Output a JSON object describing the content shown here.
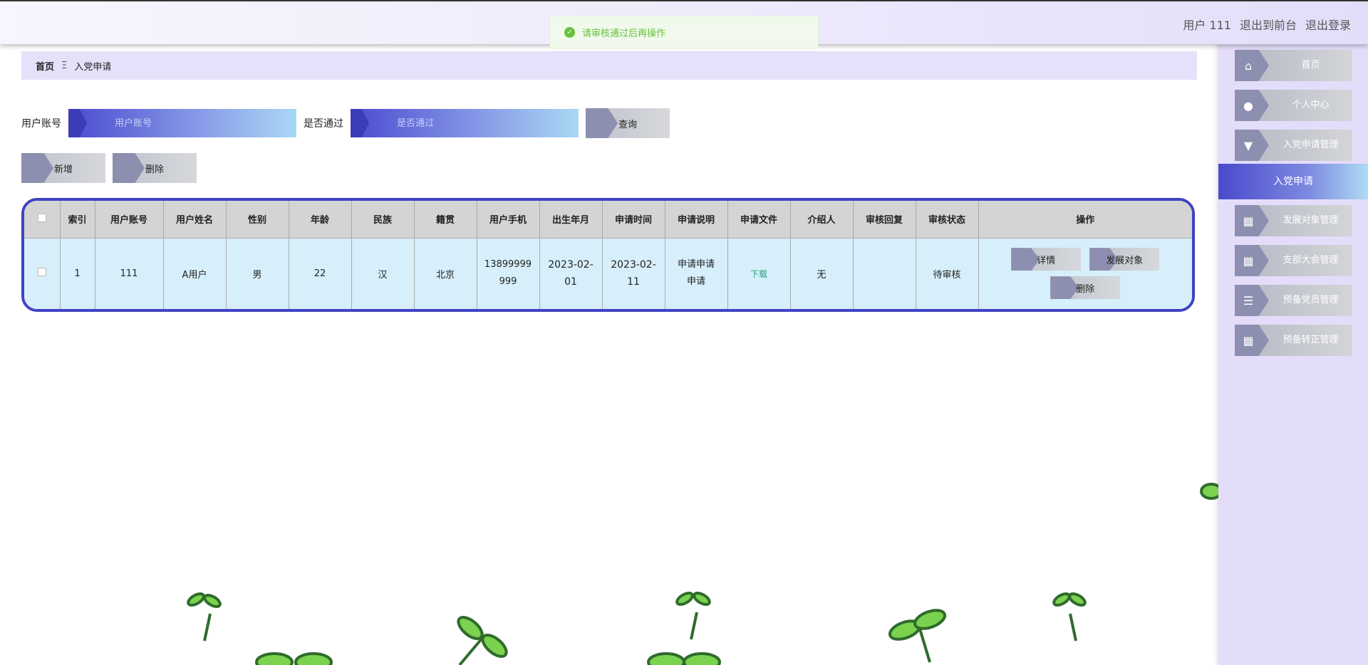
{
  "topbar": {
    "user": "用户 111",
    "to_front": "退出到前台",
    "logout": "退出登录"
  },
  "toast": {
    "message": "请审核通过后再操作",
    "icon": "check-circle-icon"
  },
  "breadcrumb": {
    "home": "首页",
    "separator": "Ξ",
    "current": "入党申请"
  },
  "search": {
    "account_label": "用户账号",
    "account_placeholder": "用户账号",
    "passed_label": "是否通过",
    "passed_placeholder": "是否通过",
    "query_button": "查询"
  },
  "actions": {
    "add": "新增",
    "delete": "删除"
  },
  "table": {
    "columns": [
      "索引",
      "用户账号",
      "用户姓名",
      "性别",
      "年龄",
      "民族",
      "籍贯",
      "用户手机",
      "出生年月",
      "申请时间",
      "申请说明",
      "申请文件",
      "介绍人",
      "审核回复",
      "审核状态",
      "操作"
    ],
    "rows": [
      {
        "index": "1",
        "account": "111",
        "name": "A用户",
        "gender": "男",
        "age": "22",
        "ethnicity": "汉",
        "origin": "北京",
        "phone": "13899999999",
        "birth": "2023-02-01",
        "apply_time": "2023-02-11",
        "description": "申请申请申请",
        "file": "下载",
        "introducer": "无",
        "reply": "",
        "status": "待审核",
        "ops": [
          "详情",
          "发展对象",
          "删除"
        ]
      }
    ]
  },
  "sidebar": {
    "items": [
      {
        "label": "首页",
        "icon": "home-icon"
      },
      {
        "label": "个人中心",
        "icon": "user-icon"
      },
      {
        "label": "入党申请管理",
        "icon": "flag-icon"
      },
      {
        "label": "入党申请",
        "active": true
      },
      {
        "label": "发展对象管理",
        "icon": "grid-icon"
      },
      {
        "label": "支部大会管理",
        "icon": "grid-icon"
      },
      {
        "label": "预备党员管理",
        "icon": "sliders-icon"
      },
      {
        "label": "预备转正管理",
        "icon": "grid-icon"
      }
    ]
  },
  "colors": {
    "accent": "#4142c2",
    "toast_green": "#67c23a",
    "sidebar_bg": "#e4ddfa",
    "table_row_bg": "#d6effa"
  }
}
